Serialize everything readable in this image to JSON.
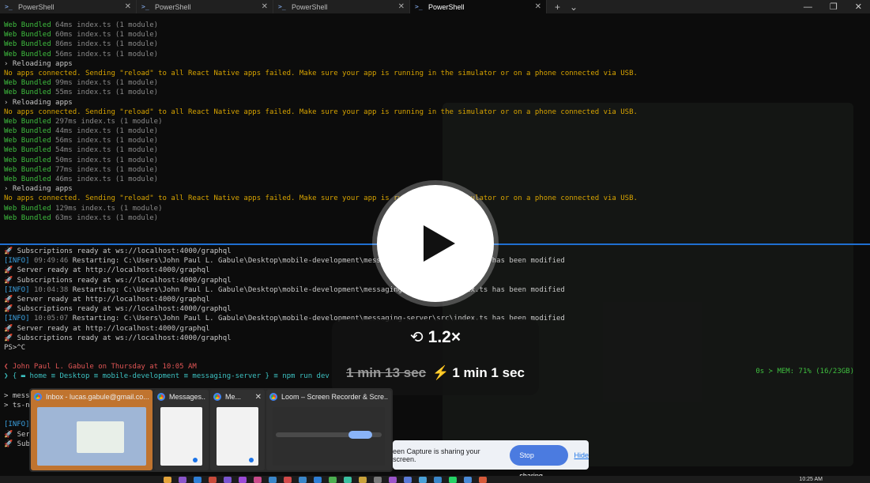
{
  "tabs": [
    {
      "title": "PowerShell",
      "active": false
    },
    {
      "title": "PowerShell",
      "active": false
    },
    {
      "title": "PowerShell",
      "active": false
    },
    {
      "title": "PowerShell",
      "active": true
    }
  ],
  "tab_actions": {
    "new_tab": "+",
    "dropdown": "⌄"
  },
  "window_controls": {
    "minimize": "—",
    "maximize": "❐",
    "close": "✕"
  },
  "pane1_lines": [
    {
      "k": "web",
      "a": "Web",
      "b": "Bundled",
      "c": "64ms index.ts (1 module)"
    },
    {
      "k": "web",
      "a": "Web",
      "b": "Bundled",
      "c": "60ms index.ts (1 module)"
    },
    {
      "k": "web",
      "a": "Web",
      "b": "Bundled",
      "c": "86ms index.ts (1 module)"
    },
    {
      "k": "web",
      "a": "Web",
      "b": "Bundled",
      "c": "56ms index.ts (1 module)"
    },
    {
      "k": "reload",
      "t": "› Reloading apps"
    },
    {
      "k": "warn",
      "t": "No apps connected. Sending \"reload\" to all React Native apps failed. Make sure your app is running in the simulator or on a phone connected via USB."
    },
    {
      "k": "web",
      "a": "Web",
      "b": "Bundled",
      "c": "99ms index.ts (1 module)"
    },
    {
      "k": "web",
      "a": "Web",
      "b": "Bundled",
      "c": "55ms index.ts (1 module)"
    },
    {
      "k": "reload",
      "t": "› Reloading apps"
    },
    {
      "k": "warn",
      "t": "No apps connected. Sending \"reload\" to all React Native apps failed. Make sure your app is running in the simulator or on a phone connected via USB."
    },
    {
      "k": "web",
      "a": "Web",
      "b": "Bundled",
      "c": "297ms index.ts (1 module)"
    },
    {
      "k": "web",
      "a": "Web",
      "b": "Bundled",
      "c": "44ms index.ts (1 module)"
    },
    {
      "k": "web",
      "a": "Web",
      "b": "Bundled",
      "c": "56ms index.ts (1 module)"
    },
    {
      "k": "web",
      "a": "Web",
      "b": "Bundled",
      "c": "54ms index.ts (1 module)"
    },
    {
      "k": "web",
      "a": "Web",
      "b": "Bundled",
      "c": "50ms index.ts (1 module)"
    },
    {
      "k": "web",
      "a": "Web",
      "b": "Bundled",
      "c": "77ms index.ts (1 module)"
    },
    {
      "k": "web",
      "a": "Web",
      "b": "Bundled",
      "c": "46ms index.ts (1 module)"
    },
    {
      "k": "reload",
      "t": "› Reloading apps"
    },
    {
      "k": "warn",
      "t": "No apps connected. Sending \"reload\" to all React Native apps failed. Make sure your app is running in the simulator or on a phone connected via USB."
    },
    {
      "k": "web",
      "a": "Web",
      "b": "Bundled",
      "c": "129ms index.ts (1 module)"
    },
    {
      "k": "web",
      "a": "Web",
      "b": "Bundled",
      "c": "63ms index.ts (1 module)"
    }
  ],
  "pane2_lines": [
    {
      "k": "rocket",
      "t": "Subscriptions ready at ws://localhost:4000/graphql"
    },
    {
      "k": "info",
      "tag": "[INFO]",
      "time": "09:49:46",
      "t": "Restarting: C:\\Users\\John Paul L. Gabule\\Desktop\\mobile-development\\messaging-server\\src\\index.ts has been modified"
    },
    {
      "k": "rocket",
      "t": "Server ready at http://localhost:4000/graphql"
    },
    {
      "k": "rocket",
      "t": "Subscriptions ready at ws://localhost:4000/graphql"
    },
    {
      "k": "info",
      "tag": "[INFO]",
      "time": "10:04:38",
      "t": "Restarting: C:\\Users\\John Paul L. Gabule\\Desktop\\mobile-development\\messaging-server\\src\\index.ts has been modified"
    },
    {
      "k": "rocket",
      "t": "Server ready at http://localhost:4000/graphql"
    },
    {
      "k": "rocket",
      "t": "Subscriptions ready at ws://localhost:4000/graphql"
    },
    {
      "k": "info",
      "tag": "[INFO]",
      "time": "10:05:07",
      "t": "Restarting: C:\\Users\\John Paul L. Gabule\\Desktop\\mobile-development\\messaging-server\\src\\index.ts has been modified"
    },
    {
      "k": "rocket",
      "t": "Server ready at http://localhost:4000/graphql"
    },
    {
      "k": "rocket",
      "t": "Subscriptions ready at ws://localhost:4000/graphql"
    },
    {
      "k": "plain",
      "t": "PS>^C"
    },
    {
      "k": "blank",
      "t": ""
    },
    {
      "k": "user",
      "t": "❮ John Paul L. Gabule on Thursday at 10:05 AM"
    },
    {
      "k": "prompt",
      "t": "❯ { ▬ home ≡ Desktop ≡ mobile-development ≡ messaging-server } ≡ npm run dev"
    },
    {
      "k": "blank",
      "t": ""
    },
    {
      "k": "plain",
      "t": "> messaging-server@1.0.0 dev"
    },
    {
      "k": "plain",
      "t": "> ts-node-dev src/index.ts"
    },
    {
      "k": "blank",
      "t": ""
    },
    {
      "k": "info",
      "tag": "[INFO]",
      "time": "",
      "t": ""
    },
    {
      "k": "rocket",
      "t": "Server ready at http://localhost:4000/graphql"
    },
    {
      "k": "rocket",
      "t": "Subscriptions ready at ws://localhost:4000/graphql"
    }
  ],
  "mem_status": "0s ≻ MEM: 71% (16/23GB)",
  "player": {
    "speed": "1.2×",
    "original_duration": "1 min 13 sec",
    "new_duration": "1 min 1 sec"
  },
  "thumbnails": [
    {
      "title": "Inbox - lucas.gabule@gmail.co...",
      "kind": "mail",
      "hover": true
    },
    {
      "title": "Messages...",
      "kind": "page",
      "hover": false
    },
    {
      "title": "Me...",
      "kind": "page",
      "hover": false,
      "close": "✕"
    },
    {
      "title": "Loom – Screen Recorder & Scre...",
      "kind": "loom",
      "hover": false
    }
  ],
  "sharebar": {
    "message": "een Capture is sharing your screen.",
    "stop_label": "Stop sharing",
    "hide_label": "Hide"
  },
  "taskbar": {
    "clock": "10:25 AM",
    "icon_colors": [
      "#e3a33a",
      "#8a55c9",
      "#2f7fd6",
      "#c84a3a",
      "#7a55d0",
      "#9b4ad6",
      "#c94a8a",
      "#3a86c9",
      "#d24a4a",
      "#3a86c9",
      "#2f7fd6",
      "#4caf50",
      "#3ac0a0",
      "#c9a23a",
      "#7a7a7a",
      "#9b55c9",
      "#5a7ad6",
      "#4aa0d6",
      "#3a86c9",
      "#25d366",
      "#4a8ad6",
      "#d65a3a"
    ]
  }
}
